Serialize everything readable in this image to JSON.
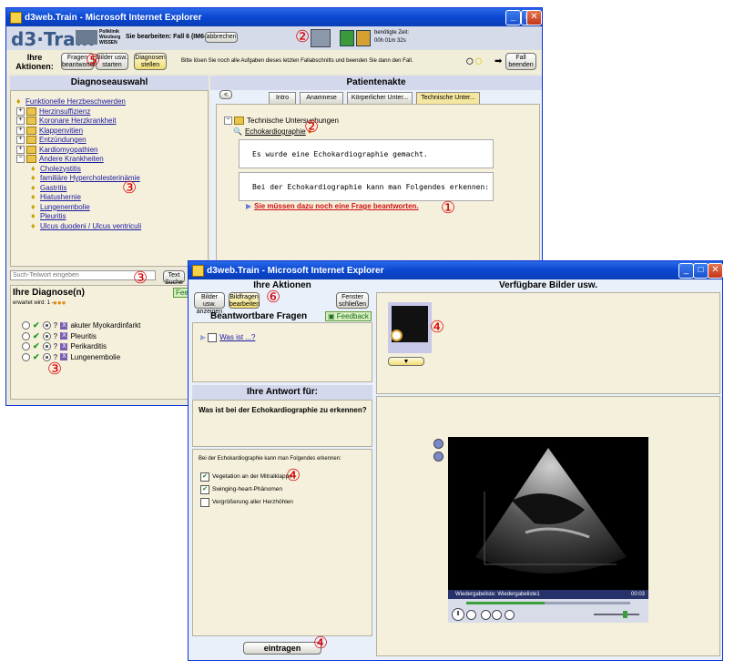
{
  "win1": {
    "title": "d3web.Train - Microsoft Internet Explorer",
    "logo": "d3·Train",
    "logo_sub": "Poliklinik Würzburg WISSEN",
    "case_label": "Sie bearbeiten: Fall 6 (IM6-10)",
    "abort_button": "abbrechen",
    "time_label": "benötigte Zeit:",
    "time_value": "00h 01m 32s",
    "actions_label": "Ihre Aktionen:",
    "btn_questions": "Fragen beantworten",
    "btn_images": "Bilder usw. starten",
    "btn_diagnoses": "Diagnosen stellen",
    "instruction": "Bitte lösen Sie noch alle Aufgaben dieses letzten Fallabschnitts und beenden Sie dann den Fall.",
    "btn_end_case": "Fall beenden",
    "diag_header": "Diagnoseauswahl",
    "diag_tree": [
      {
        "label": "Funktionelle Herzbeschwerden",
        "kind": "leaf"
      },
      {
        "label": "Herzinsuffizienz",
        "kind": "folder"
      },
      {
        "label": "Koronare Herzkrankheit",
        "kind": "folder"
      },
      {
        "label": "Klappenvitien",
        "kind": "folder"
      },
      {
        "label": "Entzündungen",
        "kind": "folder"
      },
      {
        "label": "Kardiomyopathien",
        "kind": "folder"
      },
      {
        "label": "Andere Krankheiten",
        "kind": "open"
      },
      {
        "label": "Cholezystitis",
        "kind": "child"
      },
      {
        "label": "familiäre Hypercholesterinämie",
        "kind": "child"
      },
      {
        "label": "Gastritis",
        "kind": "child"
      },
      {
        "label": "Hiatushernie",
        "kind": "child"
      },
      {
        "label": "Lungenembolie",
        "kind": "child"
      },
      {
        "label": "Pleuritis",
        "kind": "child"
      },
      {
        "label": "Ulcus duodeni / Ulcus ventriculi",
        "kind": "child"
      }
    ],
    "search_placeholder": "Such-Teilwort eingeben",
    "search_button": "Text Suche",
    "your_diagnoses": "Ihre Diagnose(n)",
    "expected": "erwartet wird: 1 -",
    "feedback_badge": "Feedb",
    "diagnoses": [
      "akuter Myokardinfarkt",
      "Pleuritis",
      "Perikarditis",
      "Lungenembolie"
    ],
    "record_header": "Patientenakte",
    "back_button": "<",
    "tabs": [
      "Intro",
      "Anamnese",
      "Körperlicher Unter...",
      "Technische Unter..."
    ],
    "record_folder": "Technische Untersuchungen",
    "record_item": "Echokardiographie",
    "text1": "Es wurde eine Echokardiographie gemacht.",
    "text2": "Bei der Echokardiographie kann man Folgendes erkennen:",
    "red_link": "Sie müssen dazu noch eine Frage beantworten."
  },
  "win2": {
    "title": "d3web.Train - Microsoft Internet Explorer",
    "actions_header": "Ihre Aktionen",
    "btn_show_images": "Bilder usw. anzeigen",
    "btn_image_questions": "Bildfragen bearbeiten",
    "btn_close_window": "Fenster schließen",
    "answerable_header": "Beantwortbare Fragen",
    "feedback": "Feedback",
    "question_link": "Was ist ...?",
    "answer_header": "Ihre Antwort für:",
    "question_text": "Was ist bei der Echokardiographie zu erkennen?",
    "answer_intro": "Bei der Echokardiographie kann man Folgendes erkennen:",
    "options": [
      {
        "label": "Vegetation an der Mitralklappe",
        "checked": true
      },
      {
        "label": "Swinging-heart-Phänomen",
        "checked": true
      },
      {
        "label": "Vergrößerung aller Herzhöhlen",
        "checked": false
      }
    ],
    "submit_button": "eintragen",
    "images_header": "Verfügbare Bilder usw.",
    "player_playlist": "Wiedergabeliste: Wiedergabeliste1",
    "player_time": "00:03"
  },
  "annotations": [
    "①",
    "②",
    "③",
    "④",
    "⑤",
    "⑥"
  ]
}
